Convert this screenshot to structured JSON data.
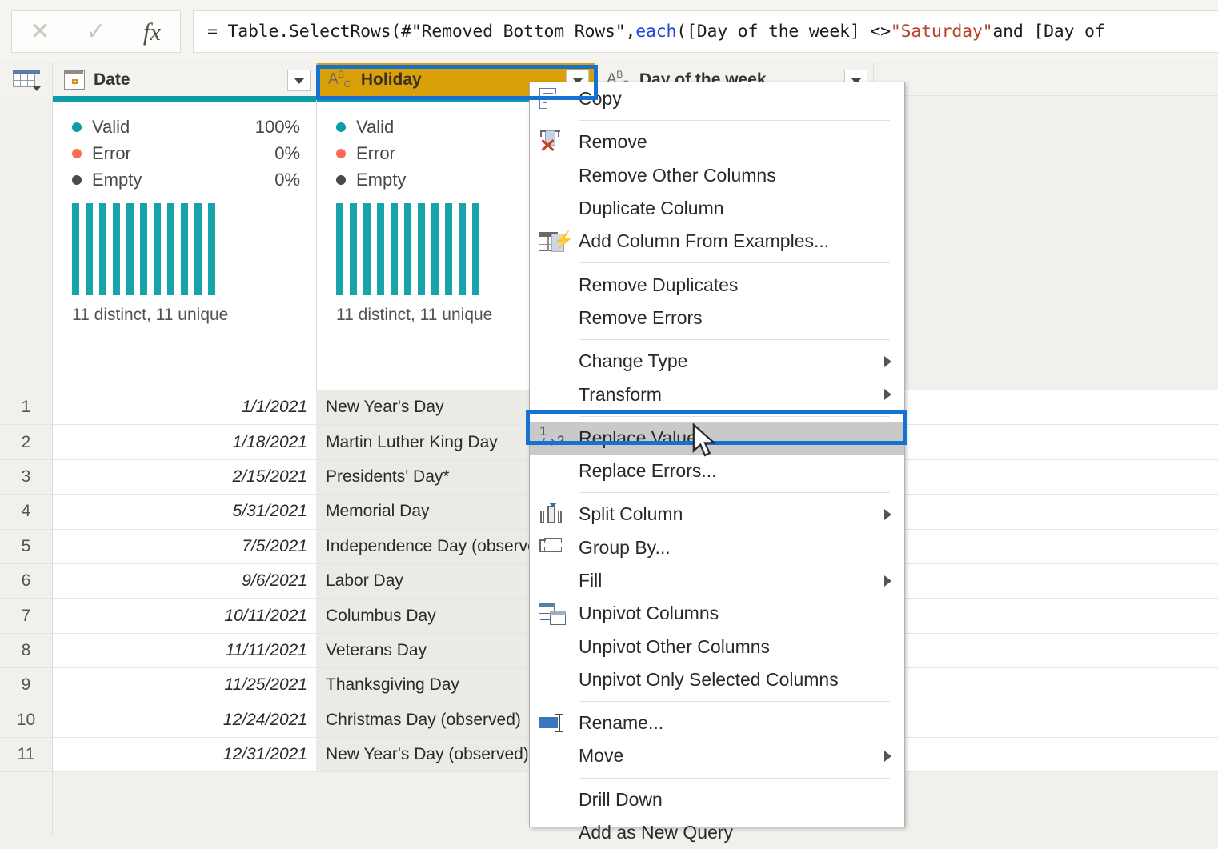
{
  "formula_bar": {
    "cancel_icon": "close-x-icon",
    "commit_icon": "check-icon",
    "fx_icon": "fx-icon",
    "formula_segments": [
      {
        "text": "= Table.SelectRows(#\"Removed Bottom Rows\", ",
        "kind": "plain"
      },
      {
        "text": "each",
        "kind": "keyword"
      },
      {
        "text": " ([Day of the week] <> ",
        "kind": "plain"
      },
      {
        "text": "\"Saturday\"",
        "kind": "string"
      },
      {
        "text": " and [Day of",
        "kind": "plain"
      }
    ],
    "formula_full": "= Table.SelectRows(#\"Removed Bottom Rows\", each ([Day of the week] <> \"Saturday\" and [Day of"
  },
  "grid": {
    "corner_icon": "table-select-all-icon",
    "columns": [
      {
        "name": "Date",
        "type_badge": "date-icon",
        "type_text": "",
        "selected": false
      },
      {
        "name": "Holiday",
        "type_badge": "ABC",
        "type_text": "ABC",
        "selected": true
      },
      {
        "name": "Day of the week",
        "type_badge": "ABC",
        "type_text": "ABC",
        "selected": false
      }
    ],
    "profiles": [
      {
        "column": "Date",
        "quality": [
          {
            "label": "Valid",
            "value": "100%",
            "dot": "valid"
          },
          {
            "label": "Error",
            "value": "0%",
            "dot": "error"
          },
          {
            "label": "Empty",
            "value": "0%",
            "dot": "empty"
          }
        ],
        "distinct_text": "11 distinct, 11 unique",
        "histogram_bars": 11
      },
      {
        "column": "Holiday",
        "quality": [
          {
            "label": "Valid",
            "value": "",
            "dot": "valid"
          },
          {
            "label": "Error",
            "value": "",
            "dot": "error"
          },
          {
            "label": "Empty",
            "value": "",
            "dot": "empty"
          }
        ],
        "distinct_text": "11 distinct, 11 unique",
        "histogram_bars": 11
      }
    ],
    "rows": [
      {
        "num": "1",
        "date": "1/1/2021",
        "holiday": "New Year's Day",
        "dow": ""
      },
      {
        "num": "2",
        "date": "1/18/2021",
        "holiday": "Martin Luther King Day",
        "dow": ""
      },
      {
        "num": "3",
        "date": "2/15/2021",
        "holiday": "Presidents' Day*",
        "dow": ""
      },
      {
        "num": "4",
        "date": "5/31/2021",
        "holiday": "Memorial Day",
        "dow": ""
      },
      {
        "num": "5",
        "date": "7/5/2021",
        "holiday": "Independence Day (observed)",
        "dow": ""
      },
      {
        "num": "6",
        "date": "9/6/2021",
        "holiday": "Labor Day",
        "dow": ""
      },
      {
        "num": "7",
        "date": "10/11/2021",
        "holiday": "Columbus Day",
        "dow": ""
      },
      {
        "num": "8",
        "date": "11/11/2021",
        "holiday": "Veterans Day",
        "dow": ""
      },
      {
        "num": "9",
        "date": "11/25/2021",
        "holiday": "Thanksgiving Day",
        "dow": ""
      },
      {
        "num": "10",
        "date": "12/24/2021",
        "holiday": "Christmas Day (observed)",
        "dow": ""
      },
      {
        "num": "11",
        "date": "12/31/2021",
        "holiday": "New Year's Day (observed)",
        "dow": ""
      }
    ]
  },
  "context_menu": {
    "items": [
      {
        "label": "Copy",
        "icon": "copy-icon",
        "submenu": false,
        "highlighted": false
      },
      {
        "sep": true
      },
      {
        "label": "Remove",
        "icon": "remove-column-icon",
        "submenu": false,
        "highlighted": false
      },
      {
        "label": "Remove Other Columns",
        "icon": "",
        "submenu": false,
        "highlighted": false
      },
      {
        "label": "Duplicate Column",
        "icon": "",
        "submenu": false,
        "highlighted": false
      },
      {
        "label": "Add Column From Examples...",
        "icon": "add-column-from-examples-icon",
        "submenu": false,
        "highlighted": false
      },
      {
        "sep": true
      },
      {
        "label": "Remove Duplicates",
        "icon": "",
        "submenu": false,
        "highlighted": false
      },
      {
        "label": "Remove Errors",
        "icon": "",
        "submenu": false,
        "highlighted": false
      },
      {
        "sep": true
      },
      {
        "label": "Change Type",
        "icon": "",
        "submenu": true,
        "highlighted": false
      },
      {
        "label": "Transform",
        "icon": "",
        "submenu": true,
        "highlighted": false
      },
      {
        "sep": true
      },
      {
        "label": "Replace Values...",
        "icon": "replace-values-icon",
        "submenu": false,
        "highlighted": true
      },
      {
        "label": "Replace Errors...",
        "icon": "",
        "submenu": false,
        "highlighted": false
      },
      {
        "sep": true
      },
      {
        "label": "Split Column",
        "icon": "split-column-icon",
        "submenu": true,
        "highlighted": false
      },
      {
        "label": "Group By...",
        "icon": "group-by-icon",
        "submenu": false,
        "highlighted": false
      },
      {
        "label": "Fill",
        "icon": "",
        "submenu": true,
        "highlighted": false
      },
      {
        "label": "Unpivot Columns",
        "icon": "unpivot-icon",
        "submenu": false,
        "highlighted": false
      },
      {
        "label": "Unpivot Other Columns",
        "icon": "",
        "submenu": false,
        "highlighted": false
      },
      {
        "label": "Unpivot Only Selected Columns",
        "icon": "",
        "submenu": false,
        "highlighted": false
      },
      {
        "sep": true
      },
      {
        "label": "Rename...",
        "icon": "rename-icon",
        "submenu": false,
        "highlighted": false
      },
      {
        "label": "Move",
        "icon": "",
        "submenu": true,
        "highlighted": false
      },
      {
        "sep": true
      },
      {
        "label": "Drill Down",
        "icon": "",
        "submenu": false,
        "highlighted": false
      },
      {
        "label": "Add as New Query",
        "icon": "",
        "submenu": false,
        "highlighted": false
      }
    ]
  },
  "annotations": {
    "highlight_color": "#1572d3",
    "selected_header_color": "#d9a107",
    "quality_bar_color": "#0d9ba5",
    "highlights": [
      {
        "target": "Holiday column header"
      },
      {
        "target": "Replace Values... menu item"
      }
    ]
  },
  "cursor": {
    "icon": "mouse-pointer-icon"
  }
}
